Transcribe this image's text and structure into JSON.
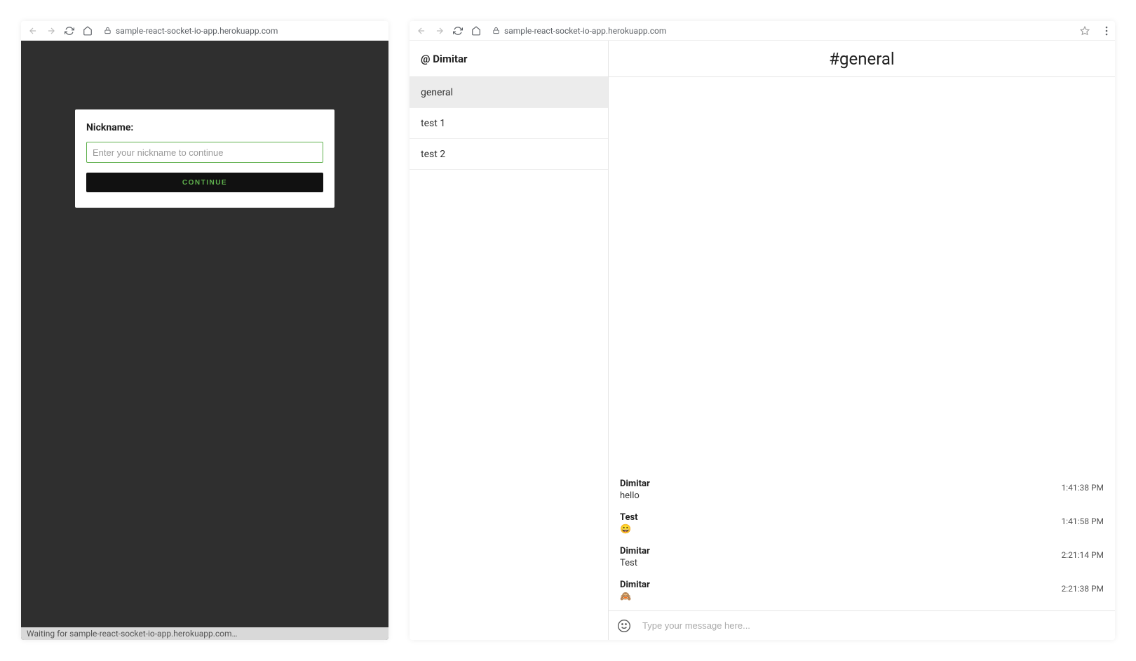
{
  "browser": {
    "url": "sample-react-socket-io-app.herokuapp.com"
  },
  "login": {
    "label": "Nickname:",
    "placeholder": "Enter your nickname to continue",
    "button": "CONTINUE",
    "status": "Waiting for sample-react-socket-io-app.herokuapp.com…"
  },
  "chat": {
    "username_prefix": "@",
    "username": "Dimitar",
    "channels": [
      {
        "name": "general",
        "active": true
      },
      {
        "name": "test 1",
        "active": false
      },
      {
        "name": "test 2",
        "active": false
      }
    ],
    "active_channel_title": "#general",
    "messages": [
      {
        "user": "Dimitar",
        "text": "hello",
        "time": "1:41:38 PM"
      },
      {
        "user": "Test",
        "text": "😀",
        "time": "1:41:58 PM"
      },
      {
        "user": "Dimitar",
        "text": "Test",
        "time": "2:21:14 PM"
      },
      {
        "user": "Dimitar",
        "text": "🙈",
        "time": "2:21:38 PM"
      }
    ],
    "composer_placeholder": "Type your message here..."
  }
}
